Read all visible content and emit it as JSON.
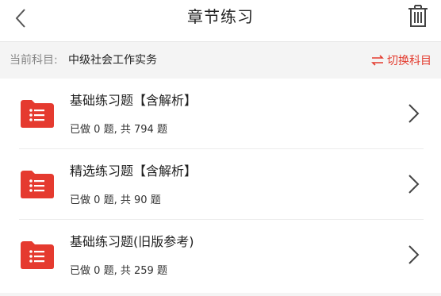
{
  "header": {
    "title": "章节练习",
    "back_icon": "chevron-left-icon",
    "trash_icon": "trash-icon"
  },
  "subject": {
    "label": "当前科目:",
    "value": "中级社会工作实务",
    "switch_label": "切换科目",
    "switch_icon": "swap-arrows-icon"
  },
  "colors": {
    "accent": "#e33b2e",
    "folder": "#e53a2f"
  },
  "exercises": [
    {
      "title": "基础练习题【含解析】",
      "done_prefix": "已做",
      "done": "0",
      "done_unit": "题,",
      "total_prefix": "共",
      "total": "794",
      "total_unit": "题"
    },
    {
      "title": "精选练习题【含解析】",
      "done_prefix": "已做",
      "done": "0",
      "done_unit": "题,",
      "total_prefix": "共",
      "total": "90",
      "total_unit": "题"
    },
    {
      "title": "基础练习题(旧版参考)",
      "done_prefix": "已做",
      "done": "0",
      "done_unit": "题,",
      "total_prefix": "共",
      "total": "259",
      "total_unit": "题"
    }
  ]
}
